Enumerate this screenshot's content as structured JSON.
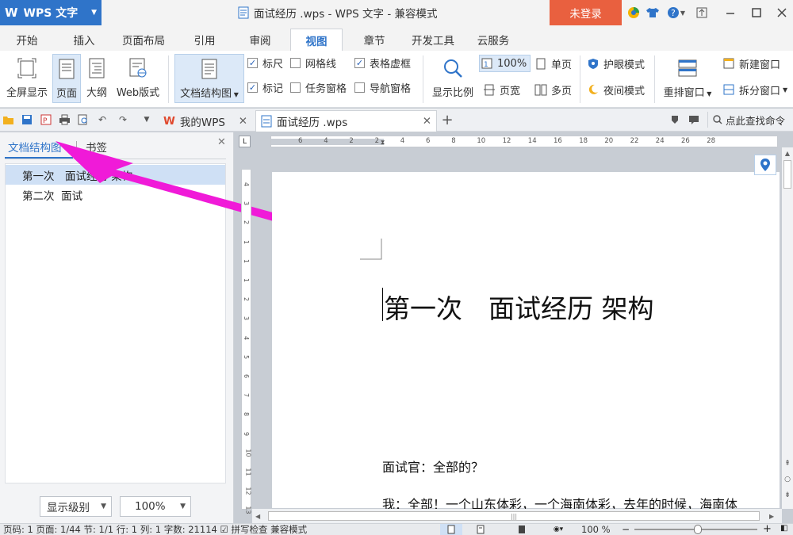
{
  "titlebar": {
    "app_name": "WPS 文字",
    "doc_title": "面试经历 .wps - WPS 文字 - 兼容模式",
    "login_label": "未登录"
  },
  "menu_tabs": [
    "开始",
    "插入",
    "页面布局",
    "引用",
    "审阅",
    "视图",
    "章节",
    "开发工具",
    "云服务"
  ],
  "active_tab": "视图",
  "ribbon": {
    "fullscreen": "全屏显示",
    "page": "页面",
    "outline": "大纲",
    "web": "Web版式",
    "docmap": "文档结构图",
    "checks": {
      "ruler": "标尺",
      "gridlines": "网格线",
      "table_gridlines": "表格虚框",
      "marks": "标记",
      "task_pane": "任务窗格",
      "nav_pane": "导航窗格"
    },
    "zoom": "显示比例",
    "zoom_100": "100%",
    "single_page": "单页",
    "page_width": "页宽",
    "multi_page": "多页",
    "eye_mode": "护眼模式",
    "night_mode": "夜间模式",
    "arrange": "重排窗口",
    "new_window": "新建窗口",
    "split_window": "拆分窗口"
  },
  "doc_tabs": {
    "mywps": "我的WPS",
    "current": "面试经历 .wps"
  },
  "search_label": "点此查找命令",
  "left_pane": {
    "tab_docmap": "文档结构图",
    "tab_bookmarks": "书签",
    "items": [
      "第一次　面试经历 架构",
      "第二次  面试"
    ],
    "level_label": "显示级别",
    "zoom_value": "100%"
  },
  "ruler_numbers": [
    "6",
    "4",
    "2",
    "2",
    "4",
    "6",
    "8",
    "10",
    "12",
    "14",
    "16",
    "18",
    "20",
    "22",
    "24",
    "26",
    "28"
  ],
  "vruler_numbers": [
    "4",
    "3",
    "2",
    "1",
    "1",
    "1",
    "2",
    "3",
    "4",
    "5",
    "6",
    "7",
    "8",
    "9",
    "10",
    "11",
    "12",
    "13"
  ],
  "document": {
    "heading": "第一次　面试经历 架构",
    "para1": "面试官：全部的？",
    "para2": "我：全部！一个山东体彩，一个海南体彩，去年的时候，海南体"
  },
  "statusbar": {
    "text": "页码: 1  页面: 1/44  节: 1/1  行: 1  列: 1  字数: 21114  ☑ 拼写检查  兼容模式",
    "zoom": "100 %"
  },
  "colors": {
    "accent": "#2f74c9",
    "login": "#e9603f",
    "annotation_arrow": "#f01ad8"
  }
}
